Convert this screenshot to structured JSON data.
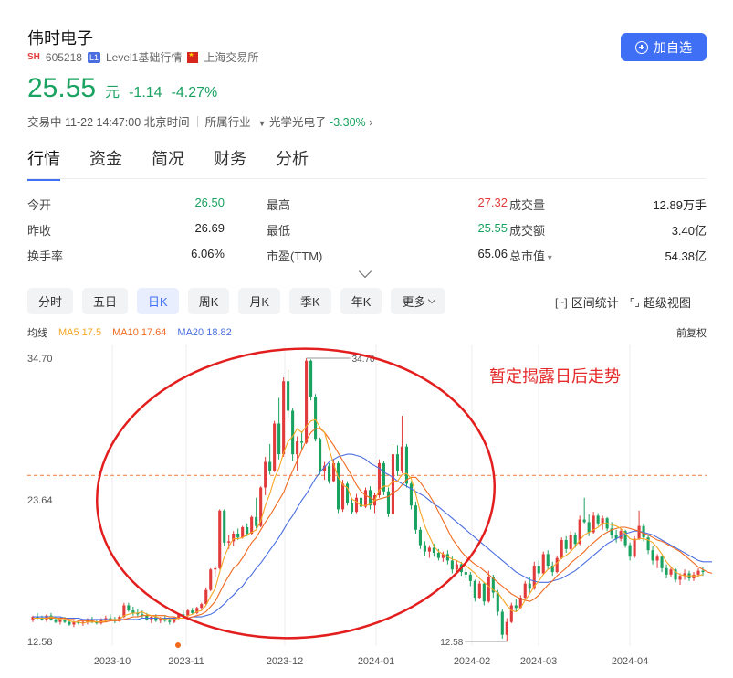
{
  "header": {
    "stock_name": "伟时电子",
    "exchange_tag": "SH",
    "code": "605218",
    "level_tag": "L1",
    "level_text": "Level1基础行情",
    "exchange_name": "上海交易所",
    "add_button": "加自选"
  },
  "quote": {
    "price": "25.55",
    "unit": "元",
    "change": "-1.14",
    "change_pct": "-4.27%"
  },
  "status": {
    "trading": "交易中 11-22 14:47:00 北京时间",
    "industry_label": "所属行业",
    "industry_name": "光学光电子",
    "industry_change": "-3.30%"
  },
  "tabs": [
    "行情",
    "资金",
    "简况",
    "财务",
    "分析"
  ],
  "stats": {
    "rows": [
      [
        {
          "label": "今开",
          "value": "26.50",
          "color": "green"
        },
        {
          "label": "最高",
          "value": "27.32",
          "color": "red"
        },
        {
          "label": "成交量",
          "value": "12.89万手",
          "color": ""
        }
      ],
      [
        {
          "label": "昨收",
          "value": "26.69",
          "color": ""
        },
        {
          "label": "最低",
          "value": "25.55",
          "color": "green"
        },
        {
          "label": "成交额",
          "value": "3.40亿",
          "color": ""
        }
      ],
      [
        {
          "label": "换手率",
          "value": "6.06%",
          "color": ""
        },
        {
          "label": "市盈(TTM)",
          "value": "65.06",
          "color": ""
        },
        {
          "label": "总市值",
          "value": "54.38亿",
          "color": ""
        }
      ]
    ]
  },
  "periods": [
    "分时",
    "五日",
    "日K",
    "周K",
    "月K",
    "季K",
    "年K",
    "更多"
  ],
  "active_period": "日K",
  "tools": {
    "range_stats": "区间统计",
    "super_view": "超级视图",
    "range_icon": "range-bracket-icon",
    "view_icon": "expand-frame-icon"
  },
  "ma": {
    "label": "均线",
    "ma5": "MA5 17.5",
    "ma10": "MA10 17.64",
    "ma20": "MA20 18.82",
    "adjust": "前复权",
    "colors": {
      "ma5": "#f5a623",
      "ma10": "#f06a1e",
      "ma20": "#4a6ee0"
    }
  },
  "annotation": "暂定揭露日后走势",
  "chart_data": {
    "type": "candlestick",
    "y_ticks": [
      "34.70",
      "23.64",
      "12.58"
    ],
    "ylim": [
      12.58,
      34.7
    ],
    "x_ticks": [
      "2023-10",
      "2023-11",
      "2023-12",
      "2024-01",
      "2024-02",
      "2024-03",
      "2024-04"
    ],
    "high_label": "34.70",
    "low_label": "12.58",
    "ref_line": 25.55,
    "ohlc": [
      [
        14.3,
        14.6,
        14.1,
        14.5
      ],
      [
        14.5,
        14.8,
        14.3,
        14.4
      ],
      [
        14.4,
        14.6,
        14.2,
        14.3
      ],
      [
        14.3,
        14.7,
        14.1,
        14.6
      ],
      [
        14.6,
        14.8,
        14.2,
        14.3
      ],
      [
        14.3,
        14.5,
        14.0,
        14.1
      ],
      [
        14.1,
        14.4,
        13.9,
        14.3
      ],
      [
        14.3,
        14.5,
        14.0,
        14.1
      ],
      [
        14.1,
        14.3,
        13.8,
        13.9
      ],
      [
        13.9,
        14.2,
        13.7,
        14.1
      ],
      [
        14.1,
        14.3,
        13.9,
        14.0
      ],
      [
        14.0,
        14.2,
        13.8,
        14.1
      ],
      [
        14.1,
        14.4,
        13.9,
        14.2
      ],
      [
        14.2,
        14.5,
        14.0,
        14.1
      ],
      [
        14.1,
        14.3,
        13.9,
        14.0
      ],
      [
        14.0,
        14.4,
        13.9,
        14.3
      ],
      [
        14.3,
        14.6,
        14.1,
        14.4
      ],
      [
        14.4,
        14.7,
        14.2,
        14.3
      ],
      [
        14.3,
        14.5,
        14.0,
        14.2
      ],
      [
        14.2,
        14.6,
        14.1,
        14.5
      ],
      [
        14.5,
        15.6,
        14.4,
        15.4
      ],
      [
        15.4,
        15.6,
        14.9,
        15.0
      ],
      [
        15.0,
        15.3,
        14.6,
        14.8
      ],
      [
        14.8,
        15.1,
        14.5,
        14.7
      ],
      [
        14.7,
        15.0,
        14.4,
        14.6
      ],
      [
        14.6,
        14.8,
        14.2,
        14.3
      ],
      [
        14.3,
        14.6,
        14.0,
        14.5
      ],
      [
        14.5,
        14.7,
        14.1,
        14.2
      ],
      [
        14.2,
        14.5,
        14.0,
        14.4
      ],
      [
        14.4,
        14.6,
        14.1,
        14.2
      ],
      [
        14.2,
        14.4,
        13.9,
        14.1
      ],
      [
        14.1,
        14.5,
        14.0,
        14.4
      ],
      [
        14.4,
        14.8,
        14.3,
        14.7
      ],
      [
        14.7,
        15.0,
        14.5,
        14.6
      ],
      [
        14.6,
        15.1,
        14.5,
        15.0
      ],
      [
        15.0,
        15.2,
        14.7,
        14.8
      ],
      [
        14.8,
        15.3,
        14.7,
        15.2
      ],
      [
        15.2,
        15.6,
        15.0,
        15.5
      ],
      [
        15.5,
        16.8,
        15.4,
        16.6
      ],
      [
        16.6,
        18.3,
        16.5,
        18.2
      ],
      [
        18.2,
        18.5,
        17.6,
        18.3
      ],
      [
        18.3,
        22.9,
        18.2,
        22.8
      ],
      [
        22.8,
        22.9,
        20.0,
        20.3
      ],
      [
        20.3,
        20.9,
        19.8,
        20.4
      ],
      [
        20.4,
        21.2,
        20.0,
        21.0
      ],
      [
        21.0,
        21.4,
        20.5,
        20.7
      ],
      [
        20.7,
        21.6,
        20.6,
        21.5
      ],
      [
        21.5,
        21.8,
        20.8,
        21.0
      ],
      [
        21.0,
        22.4,
        20.9,
        22.3
      ],
      [
        22.3,
        23.8,
        21.4,
        21.6
      ],
      [
        21.6,
        24.7,
        21.5,
        24.6
      ],
      [
        24.6,
        27.0,
        24.0,
        26.6
      ],
      [
        26.6,
        28.0,
        25.6,
        25.9
      ],
      [
        25.9,
        29.8,
        25.8,
        29.6
      ],
      [
        29.6,
        31.6,
        26.8,
        27.2
      ],
      [
        27.2,
        33.2,
        27.0,
        32.9
      ],
      [
        32.9,
        33.8,
        30.0,
        30.6
      ],
      [
        30.6,
        30.8,
        26.7,
        27.2
      ],
      [
        27.2,
        28.6,
        25.9,
        28.2
      ],
      [
        28.2,
        29.0,
        27.6,
        28.1
      ],
      [
        28.1,
        34.7,
        28.0,
        34.5
      ],
      [
        34.5,
        34.6,
        31.4,
        31.7
      ],
      [
        31.7,
        31.9,
        28.2,
        28.4
      ],
      [
        28.4,
        28.5,
        25.6,
        25.9
      ],
      [
        25.9,
        26.6,
        25.2,
        26.3
      ],
      [
        26.3,
        26.5,
        24.9,
        25.1
      ],
      [
        25.1,
        26.8,
        25.0,
        26.5
      ],
      [
        26.5,
        26.7,
        22.6,
        22.9
      ],
      [
        22.9,
        25.2,
        22.7,
        24.9
      ],
      [
        24.9,
        25.1,
        23.2,
        23.4
      ],
      [
        23.4,
        23.8,
        22.5,
        22.7
      ],
      [
        22.7,
        24.1,
        22.6,
        23.8
      ],
      [
        23.8,
        24.0,
        22.9,
        23.1
      ],
      [
        23.1,
        24.6,
        23.0,
        24.4
      ],
      [
        24.4,
        24.7,
        22.9,
        23.2
      ],
      [
        23.2,
        24.2,
        22.6,
        24.0
      ],
      [
        24.0,
        26.8,
        23.8,
        26.5
      ],
      [
        26.5,
        26.7,
        24.0,
        24.3
      ],
      [
        24.3,
        24.6,
        22.3,
        22.5
      ],
      [
        22.5,
        28.0,
        22.4,
        27.2
      ],
      [
        27.2,
        27.9,
        25.5,
        25.9
      ],
      [
        25.9,
        30.2,
        25.7,
        27.8
      ],
      [
        27.8,
        28.0,
        24.6,
        24.9
      ],
      [
        24.9,
        25.1,
        22.9,
        23.2
      ],
      [
        23.2,
        23.5,
        21.0,
        21.3
      ],
      [
        21.3,
        21.5,
        19.8,
        20.1
      ],
      [
        20.1,
        20.4,
        19.3,
        19.6
      ],
      [
        19.6,
        20.1,
        19.1,
        19.9
      ],
      [
        19.9,
        20.2,
        19.2,
        19.5
      ],
      [
        19.5,
        19.8,
        18.9,
        19.1
      ],
      [
        19.1,
        19.6,
        18.8,
        19.4
      ],
      [
        19.4,
        19.7,
        18.6,
        18.9
      ],
      [
        18.9,
        19.2,
        17.9,
        18.2
      ],
      [
        18.2,
        18.9,
        17.9,
        18.6
      ],
      [
        18.6,
        18.8,
        17.7,
        18.0
      ],
      [
        18.0,
        18.4,
        17.5,
        17.8
      ],
      [
        17.8,
        18.0,
        16.9,
        17.3
      ],
      [
        17.3,
        17.4,
        15.7,
        16.0
      ],
      [
        16.0,
        17.3,
        15.9,
        17.1
      ],
      [
        17.1,
        17.2,
        15.4,
        15.7
      ],
      [
        15.7,
        18.1,
        15.6,
        17.6
      ],
      [
        17.6,
        17.8,
        16.0,
        16.4
      ],
      [
        16.4,
        16.6,
        14.6,
        14.9
      ],
      [
        14.9,
        15.1,
        12.8,
        13.1
      ],
      [
        13.1,
        14.4,
        12.58,
        14.1
      ],
      [
        14.1,
        15.6,
        14.0,
        15.4
      ],
      [
        15.4,
        15.9,
        14.9,
        15.2
      ],
      [
        15.2,
        16.2,
        15.1,
        16.0
      ],
      [
        16.0,
        17.3,
        15.9,
        17.1
      ],
      [
        17.1,
        17.6,
        16.4,
        16.7
      ],
      [
        16.7,
        18.8,
        16.6,
        18.5
      ],
      [
        18.5,
        18.9,
        17.6,
        17.9
      ],
      [
        17.9,
        19.6,
        17.8,
        19.4
      ],
      [
        19.4,
        19.7,
        18.2,
        18.5
      ],
      [
        18.5,
        18.8,
        17.7,
        18.0
      ],
      [
        18.0,
        19.3,
        17.9,
        19.1
      ],
      [
        19.1,
        20.7,
        19.0,
        20.5
      ],
      [
        20.5,
        20.8,
        19.5,
        19.8
      ],
      [
        19.8,
        21.2,
        19.7,
        20.9
      ],
      [
        20.9,
        21.1,
        19.9,
        20.2
      ],
      [
        20.2,
        22.4,
        20.1,
        22.1
      ],
      [
        22.1,
        23.8,
        21.8,
        21.9
      ],
      [
        21.9,
        22.5,
        20.8,
        21.1
      ],
      [
        21.1,
        22.7,
        21.0,
        22.4
      ],
      [
        22.4,
        22.6,
        21.6,
        21.8
      ],
      [
        21.8,
        22.4,
        21.3,
        22.2
      ],
      [
        22.2,
        22.3,
        21.2,
        21.4
      ],
      [
        21.4,
        21.9,
        20.6,
        20.9
      ],
      [
        20.9,
        21.3,
        20.3,
        20.6
      ],
      [
        20.6,
        21.4,
        20.4,
        21.2
      ],
      [
        21.2,
        21.3,
        19.9,
        20.1
      ],
      [
        20.1,
        20.3,
        18.9,
        19.2
      ],
      [
        19.2,
        20.8,
        19.1,
        20.6
      ],
      [
        20.6,
        22.8,
        20.5,
        21.6
      ],
      [
        21.6,
        21.8,
        20.4,
        20.7
      ],
      [
        20.7,
        20.9,
        19.4,
        19.7
      ],
      [
        19.7,
        20.0,
        18.6,
        18.9
      ],
      [
        18.9,
        19.4,
        18.3,
        19.2
      ],
      [
        19.2,
        19.3,
        18.0,
        18.3
      ],
      [
        18.3,
        18.6,
        17.5,
        17.8
      ],
      [
        17.8,
        18.4,
        17.6,
        18.2
      ],
      [
        18.2,
        18.3,
        17.2,
        17.4
      ],
      [
        17.4,
        17.9,
        17.0,
        17.7
      ],
      [
        17.7,
        18.2,
        17.4,
        17.9
      ],
      [
        17.9,
        18.1,
        17.3,
        17.5
      ],
      [
        17.5,
        18.0,
        17.3,
        17.8
      ],
      [
        17.8,
        18.3,
        17.6,
        18.1
      ],
      [
        18.1,
        18.4,
        17.7,
        18.0
      ]
    ],
    "ma5": [
      14.4,
      14.4,
      14.4,
      14.4,
      14.5,
      14.4,
      14.3,
      14.3,
      14.2,
      14.1,
      14.1,
      14.0,
      14.1,
      14.1,
      14.1,
      14.1,
      14.2,
      14.3,
      14.3,
      14.3,
      14.6,
      14.7,
      14.8,
      14.8,
      14.9,
      14.7,
      14.6,
      14.5,
      14.4,
      14.3,
      14.3,
      14.3,
      14.4,
      14.4,
      14.6,
      14.7,
      14.9,
      15.0,
      15.4,
      16.1,
      16.7,
      18.0,
      19.2,
      20.0,
      20.6,
      20.6,
      20.7,
      20.9,
      21.1,
      21.3,
      22.0,
      23.2,
      24.1,
      25.3,
      26.1,
      27.3,
      28.2,
      28.6,
      29.2,
      28.9,
      29.4,
      29.8,
      29.9,
      29.3,
      28.9,
      27.6,
      26.4,
      25.4,
      24.8,
      24.6,
      23.7,
      23.5,
      23.2,
      23.2,
      23.3,
      23.6,
      24.4,
      24.7,
      24.7,
      25.1,
      25.1,
      25.6,
      25.7,
      25.3,
      24.1,
      22.7,
      21.6,
      20.8,
      20.0,
      19.6,
      19.4,
      19.2,
      19.0,
      18.9,
      18.7,
      18.5,
      18.2,
      17.9,
      17.5,
      17.2,
      16.9,
      16.6,
      16.4,
      15.9,
      15.4,
      15.0,
      14.9,
      15.2,
      15.8,
      16.3,
      16.9,
      17.3,
      17.8,
      18.2,
      18.4,
      18.7,
      19.1,
      19.3,
      19.6,
      20.0,
      20.5,
      20.9,
      21.1,
      21.3,
      21.5,
      21.8,
      21.8,
      21.7,
      21.6,
      21.4,
      21.0,
      20.6,
      20.5,
      20.6,
      20.6,
      20.5,
      20.3,
      19.9,
      19.4,
      18.8,
      18.4,
      18.0,
      17.8,
      17.7,
      17.7,
      17.7,
      17.7,
      17.8
    ],
    "ma10": [
      14.4,
      14.4,
      14.4,
      14.4,
      14.4,
      14.4,
      14.4,
      14.4,
      14.3,
      14.3,
      14.2,
      14.2,
      14.2,
      14.2,
      14.1,
      14.1,
      14.1,
      14.2,
      14.2,
      14.2,
      14.3,
      14.4,
      14.5,
      14.5,
      14.6,
      14.6,
      14.6,
      14.6,
      14.6,
      14.6,
      14.5,
      14.5,
      14.4,
      14.4,
      14.4,
      14.5,
      14.6,
      14.7,
      14.9,
      15.3,
      15.7,
      16.4,
      17.1,
      17.7,
      18.3,
      18.6,
      19.1,
      19.7,
      20.3,
      20.7,
      21.3,
      21.9,
      22.4,
      23.0,
      23.6,
      24.2,
      25.1,
      25.9,
      26.7,
      27.5,
      28.3,
      28.9,
      29.2,
      29.2,
      28.9,
      28.4,
      27.9,
      27.3,
      26.7,
      26.1,
      25.5,
      24.8,
      24.3,
      24.0,
      23.8,
      23.6,
      23.7,
      23.8,
      23.9,
      24.2,
      24.4,
      24.8,
      25.2,
      25.4,
      25.4,
      25.0,
      24.5,
      24.0,
      23.4,
      22.7,
      22.0,
      21.3,
      20.6,
      20.1,
      19.6,
      19.2,
      18.9,
      18.6,
      18.4,
      18.1,
      17.8,
      17.5,
      17.2,
      16.9,
      16.6,
      16.3,
      16.1,
      15.9,
      15.8,
      15.7,
      15.9,
      16.2,
      16.6,
      17.0,
      17.3,
      17.7,
      18.0,
      18.3,
      18.7,
      19.0,
      19.3,
      19.6,
      20.0,
      20.3,
      20.6,
      20.9,
      21.1,
      21.3,
      21.4,
      21.5,
      21.5,
      21.4,
      21.3,
      21.2,
      21.0,
      20.9,
      20.7,
      20.5,
      20.4,
      20.2,
      20.0,
      19.8,
      19.6,
      19.3,
      19.0,
      18.7,
      18.4,
      18.2,
      18.0,
      17.9
    ],
    "ma20": [
      14.5,
      14.5,
      14.5,
      14.5,
      14.5,
      14.5,
      14.5,
      14.4,
      14.4,
      14.4,
      14.4,
      14.3,
      14.3,
      14.3,
      14.3,
      14.3,
      14.3,
      14.3,
      14.3,
      14.3,
      14.3,
      14.3,
      14.3,
      14.3,
      14.4,
      14.4,
      14.4,
      14.4,
      14.4,
      14.4,
      14.4,
      14.4,
      14.4,
      14.4,
      14.4,
      14.5,
      14.5,
      14.5,
      14.6,
      14.7,
      14.9,
      15.2,
      15.5,
      15.9,
      16.2,
      16.6,
      16.9,
      17.4,
      17.8,
      18.3,
      18.7,
      19.2,
      19.7,
      20.2,
      20.7,
      21.3,
      21.9,
      22.4,
      23.0,
      23.6,
      24.1,
      24.7,
      25.3,
      25.8,
      26.2,
      26.6,
      26.8,
      27.0,
      27.1,
      27.2,
      27.2,
      27.1,
      27.0,
      26.8,
      26.5,
      26.3,
      26.1,
      25.8,
      25.6,
      25.4,
      25.1,
      24.9,
      24.7,
      24.5,
      24.3,
      24.1,
      23.9,
      23.6,
      23.3,
      23.1,
      22.8,
      22.5,
      22.2,
      21.9,
      21.6,
      21.3,
      21.0,
      20.7,
      20.4,
      20.1,
      19.8,
      19.5,
      19.2,
      18.9,
      18.6,
      18.3,
      18.0,
      17.8,
      17.6,
      17.4,
      17.3,
      17.2,
      17.2,
      17.2,
      17.3,
      17.4,
      17.5,
      17.7,
      17.9,
      18.1,
      18.4,
      18.7,
      19.0,
      19.3,
      19.6,
      19.9,
      20.2,
      20.4,
      20.6,
      20.8,
      21.0,
      21.1,
      21.2,
      21.2,
      21.1,
      21.0,
      20.9,
      20.7,
      20.5,
      20.3,
      20.1,
      19.9,
      19.7,
      19.5,
      19.3,
      19.1,
      18.9,
      18.8,
      18.8,
      18.8
    ]
  }
}
